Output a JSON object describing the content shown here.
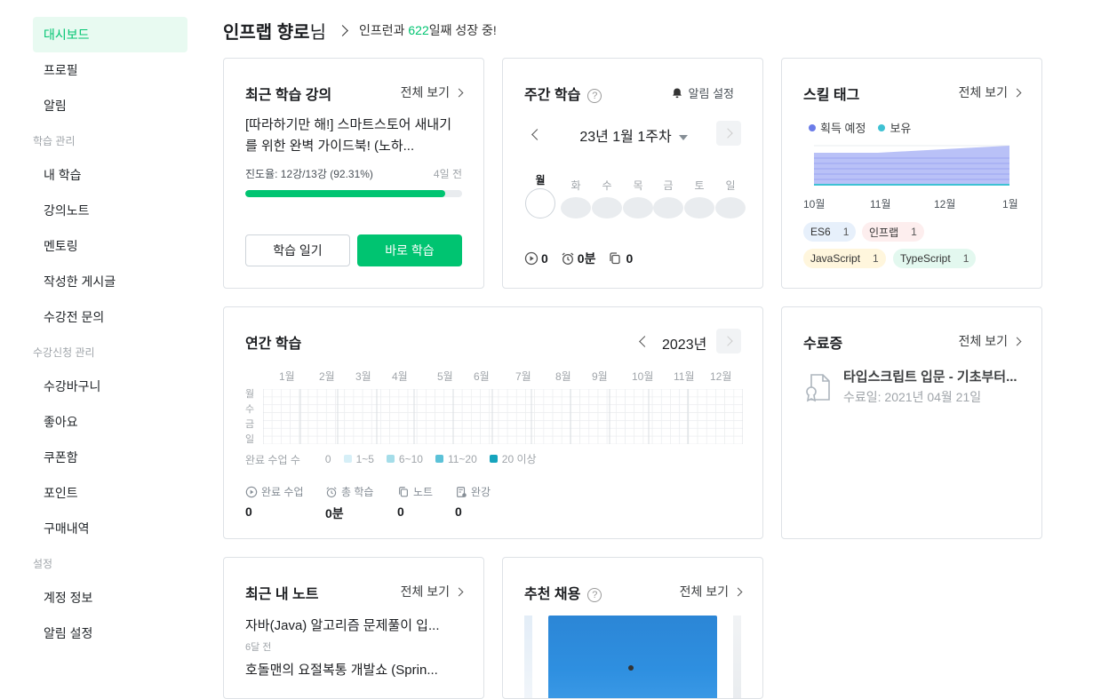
{
  "sidebar": {
    "items": [
      {
        "label": "대시보드",
        "type": "item",
        "active": true
      },
      {
        "label": "프로필",
        "type": "item"
      },
      {
        "label": "알림",
        "type": "item"
      },
      {
        "label": "학습 관리",
        "type": "head"
      },
      {
        "label": "내 학습",
        "type": "item"
      },
      {
        "label": "강의노트",
        "type": "item"
      },
      {
        "label": "멘토링",
        "type": "item"
      },
      {
        "label": "작성한 게시글",
        "type": "item"
      },
      {
        "label": "수강전 문의",
        "type": "item"
      },
      {
        "label": "수강신청 관리",
        "type": "head"
      },
      {
        "label": "수강바구니",
        "type": "item"
      },
      {
        "label": "좋아요",
        "type": "item"
      },
      {
        "label": "쿠폰함",
        "type": "item"
      },
      {
        "label": "포인트",
        "type": "item"
      },
      {
        "label": "구매내역",
        "type": "item"
      },
      {
        "label": "설정",
        "type": "head"
      },
      {
        "label": "계정 정보",
        "type": "item"
      },
      {
        "label": "알림 설정",
        "type": "item"
      }
    ]
  },
  "header": {
    "name": "인프랩 향로",
    "suffix": "님",
    "msg_pre": "인프런과 ",
    "days": "622",
    "msg_post": "일째 성장 중!"
  },
  "recent_course": {
    "title": "최근 학습 강의",
    "more": "전체 보기",
    "course_title": "[따라하기만 해!] 스마트스토어 새내기를 위한 완벽 가이드북! (노하...",
    "progress_text": "진도율: 12강/13강 (92.31%)",
    "progress": 0.9231,
    "when": "4일 전",
    "btn_notes": "학습 일기",
    "btn_study": "바로 학습"
  },
  "weekly": {
    "title": "주간 학습",
    "help": "?",
    "alarm": "알림 설정",
    "week": "23년 1월 1주차",
    "days": [
      "월",
      "화",
      "수",
      "목",
      "금",
      "토",
      "일"
    ],
    "lectures": "0",
    "time": "0분",
    "notes": "0"
  },
  "skills": {
    "title": "스킬 태그",
    "more": "전체 보기",
    "legend_planned": "획득 예정",
    "legend_owned": "보유",
    "months": [
      "10월",
      "11월",
      "12월",
      "1월"
    ],
    "tags": [
      {
        "name": "ES6",
        "count": "1",
        "color": "#e7f0fb"
      },
      {
        "name": "인프랩",
        "count": "1",
        "color": "#fdeeee"
      },
      {
        "name": "JavaScript",
        "count": "1",
        "color": "#fff6dd"
      },
      {
        "name": "TypeScript",
        "count": "1",
        "color": "#e3f8ef"
      }
    ],
    "colors": {
      "planned": "#6b7ce8",
      "owned": "#3ec1d3"
    }
  },
  "yearly": {
    "title": "연간 학습",
    "year": "2023년",
    "months": [
      "1월",
      "2월",
      "3월",
      "4월",
      "5월",
      "6월",
      "7월",
      "8월",
      "9월",
      "10월",
      "11월",
      "12월"
    ],
    "weekday_labels": [
      "월",
      "수",
      "금",
      "일"
    ],
    "legend_label": "완료 수업 수",
    "legend": [
      "0",
      "1~5",
      "6~10",
      "11~20",
      "20 이상"
    ],
    "legend_colors": [
      "#ffffff",
      "#d6eff7",
      "#a5dde9",
      "#5cc2d8",
      "#16a4bd"
    ],
    "stats": [
      {
        "label": "완료 수업",
        "value": "0"
      },
      {
        "label": "총 학습",
        "value": "0분"
      },
      {
        "label": "노트",
        "value": "0"
      },
      {
        "label": "완강",
        "value": "0"
      }
    ]
  },
  "cert": {
    "title": "수료증",
    "more": "전체 보기",
    "course": "타입스크립트 입문 - 기초부터...",
    "date": "수료일: 2021년 04월 21일"
  },
  "notes": {
    "title": "최근 내 노트",
    "more": "전체 보기",
    "items": [
      {
        "title": "자바(Java) 알고리즘 문제풀이 입...",
        "when": "6달 전"
      },
      {
        "title": "호돌맨의 요절복통 개발쇼 (Sprin..."
      }
    ]
  },
  "jobs": {
    "title": "추천 채용",
    "help": "?",
    "more": "전체 보기"
  }
}
